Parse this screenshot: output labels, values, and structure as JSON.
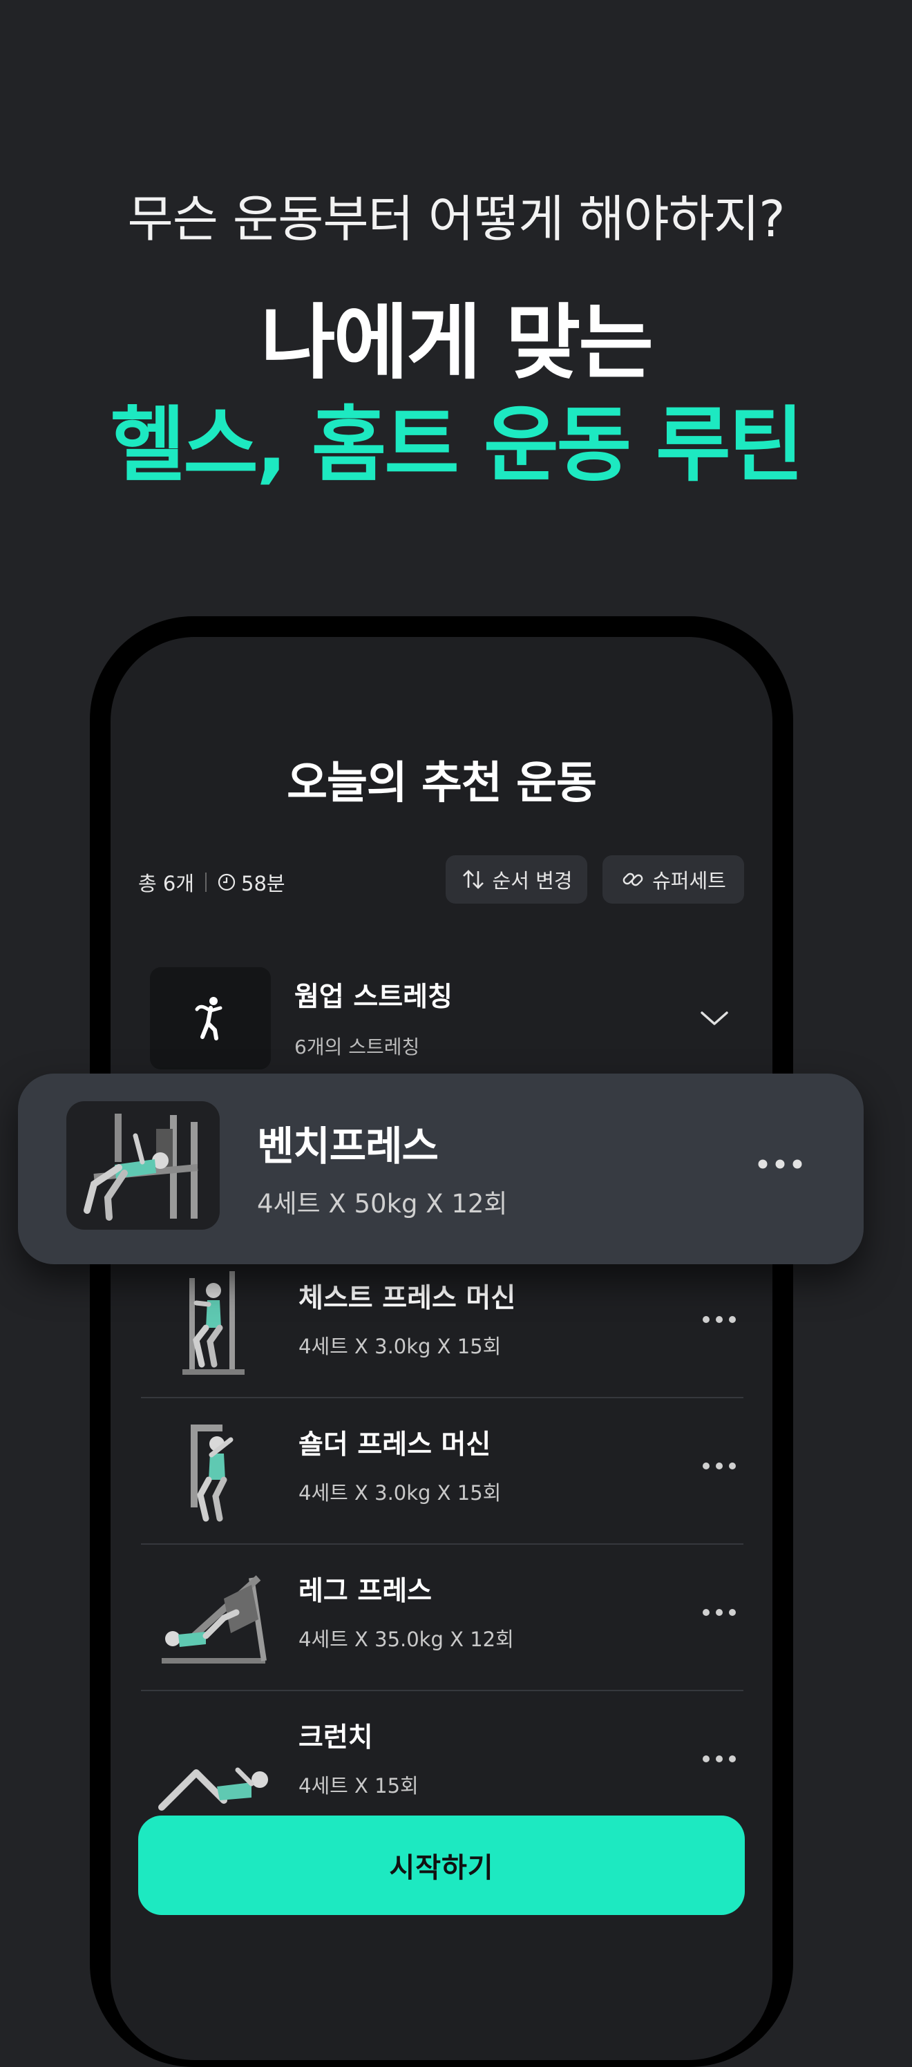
{
  "hero": {
    "subtitle": "무슨 운동부터 어떻게 해야하지?",
    "title_line1": "나에게 맞는",
    "title_line2": "헬스, 홈트 운동 루틴",
    "accent_color": "#1de9c1"
  },
  "screen": {
    "title": "오늘의 추천 운동",
    "total_count": "총 6개",
    "duration": "58분",
    "reorder_label": "순서 변경",
    "superset_label": "슈퍼세트"
  },
  "warmup": {
    "title": "웜업 스트레칭",
    "subtitle": "6개의 스트레칭",
    "icon": "stretching-person-icon"
  },
  "highlight": {
    "title": "벤치프레스",
    "subtitle": "4세트 X 50kg X 12회"
  },
  "exercises": [
    {
      "title": "체스트 프레스 머신",
      "subtitle": "4세트 X 3.0kg X 15회"
    },
    {
      "title": "숄더 프레스 머신",
      "subtitle": "4세트 X 3.0kg X 15회"
    },
    {
      "title": "레그 프레스",
      "subtitle": "4세트 X 35.0kg X 12회"
    },
    {
      "title": "크런치",
      "subtitle": "4세트 X 15회"
    }
  ],
  "start_button": "시작하기"
}
